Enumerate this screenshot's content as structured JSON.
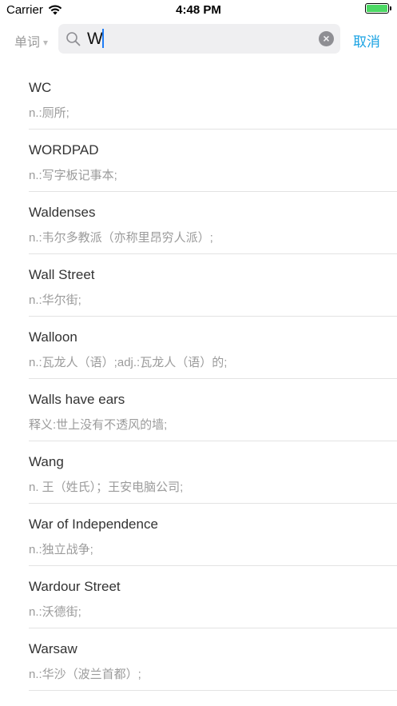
{
  "status_bar": {
    "carrier": "Carrier",
    "time": "4:48 PM",
    "battery_level": 1.0
  },
  "search": {
    "scope_label": "单词",
    "value": "W",
    "cancel_label": "取消"
  },
  "results": [
    {
      "word": "WC",
      "definition": "n.:厕所;"
    },
    {
      "word": "WORDPAD",
      "definition": "n.:写字板记事本;"
    },
    {
      "word": "Waldenses",
      "definition": "n.:韦尔多教派（亦称里昂穷人派）;"
    },
    {
      "word": "Wall Street",
      "definition": "n.:华尔街;"
    },
    {
      "word": "Walloon",
      "definition": "n.:瓦龙人（语）;adj.:瓦龙人（语）的;"
    },
    {
      "word": "Walls have ears",
      "definition": "释义:世上没有不透风的墙;"
    },
    {
      "word": "Wang",
      "definition": "n. 王（姓氏）；王安电脑公司;"
    },
    {
      "word": "War of Independence",
      "definition": "n.:独立战争;"
    },
    {
      "word": "Wardour Street",
      "definition": "n.:沃德街;"
    },
    {
      "word": "Warsaw",
      "definition": "n.:华沙（波兰首都）;"
    }
  ]
}
